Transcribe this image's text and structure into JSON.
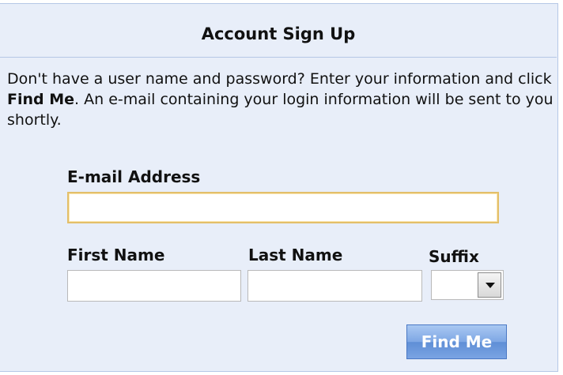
{
  "form": {
    "title": "Account Sign Up",
    "intro": {
      "before": "Don't have a user name and password? Enter your information and click ",
      "bold": "Find Me",
      "after": ". An e-mail containing your login information will be sent to you shortly."
    },
    "email": {
      "label": "E-mail Address",
      "value": "",
      "placeholder": ""
    },
    "first_name": {
      "label": "First Name",
      "value": "",
      "placeholder": ""
    },
    "last_name": {
      "label": "Last Name",
      "value": "",
      "placeholder": ""
    },
    "suffix": {
      "label": "Suffix",
      "selected": ""
    },
    "submit_label": "Find Me"
  },
  "colors": {
    "panel_background": "#e8eef9",
    "panel_border": "#b5c7e6",
    "focused_input_border": "#e3bf6a",
    "button_blue": "#6f9ae0"
  },
  "icons": {
    "suffix_dropdown": "chevron-down-icon"
  }
}
